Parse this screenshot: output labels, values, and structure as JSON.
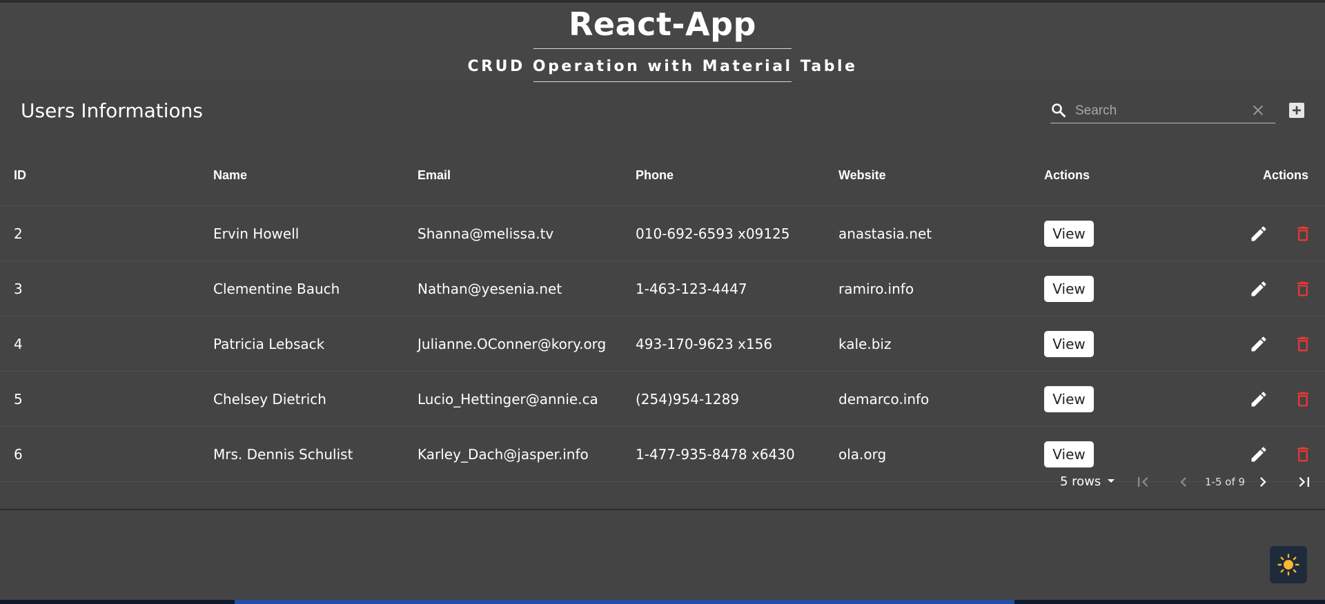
{
  "header": {
    "title": "React-App",
    "subtitle": "CRUD Operation with Material Table"
  },
  "toolbar": {
    "title": "Users Informations",
    "search_placeholder": "Search",
    "search_value": ""
  },
  "table": {
    "columns": [
      "ID",
      "Name",
      "Email",
      "Phone",
      "Website",
      "Actions",
      "Actions"
    ],
    "view_label": "View",
    "rows": [
      {
        "id": "2",
        "name": "Ervin Howell",
        "email": "Shanna@melissa.tv",
        "phone": "010-692-6593 x09125",
        "website": "anastasia.net"
      },
      {
        "id": "3",
        "name": "Clementine Bauch",
        "email": "Nathan@yesenia.net",
        "phone": "1-463-123-4447",
        "website": "ramiro.info"
      },
      {
        "id": "4",
        "name": "Patricia Lebsack",
        "email": "Julianne.OConner@kory.org",
        "phone": "493-170-9623 x156",
        "website": "kale.biz"
      },
      {
        "id": "5",
        "name": "Chelsey Dietrich",
        "email": "Lucio_Hettinger@annie.ca",
        "phone": "(254)954-1289",
        "website": "demarco.info"
      },
      {
        "id": "6",
        "name": "Mrs. Dennis Schulist",
        "email": "Karley_Dach@jasper.info",
        "phone": "1-477-935-8478 x6430",
        "website": "ola.org"
      }
    ]
  },
  "pagination": {
    "rows_label": "5 rows",
    "range": "1-5 of 9"
  },
  "colors": {
    "background": "#444444",
    "delete": "#e53935",
    "theme_toggle_bg": "#1f2a3a",
    "sun": "#f5b82e"
  },
  "icons": [
    "search-icon",
    "clear-icon",
    "add-icon",
    "edit-icon",
    "delete-icon",
    "first-page-icon",
    "previous-page-icon",
    "next-page-icon",
    "last-page-icon",
    "sun-icon"
  ]
}
